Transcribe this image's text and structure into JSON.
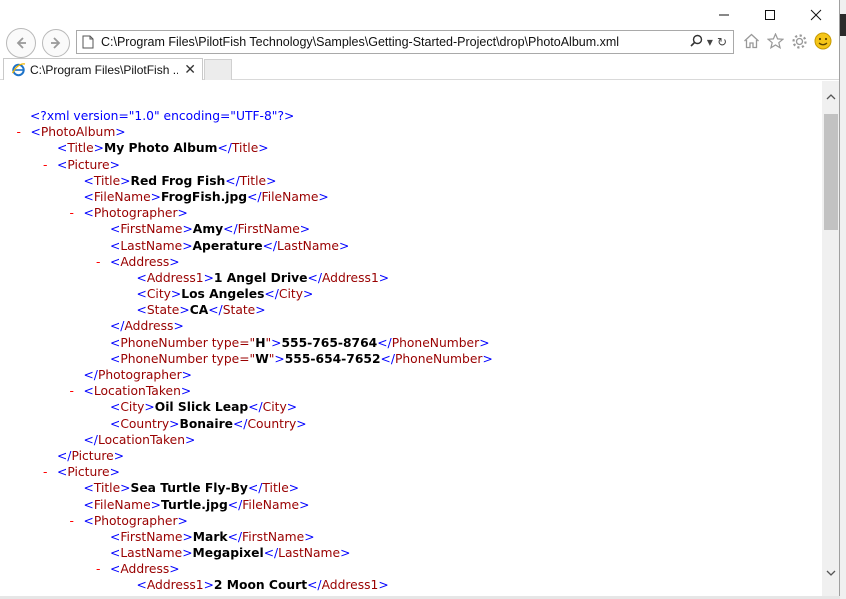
{
  "window": {
    "minimize_glyph": "—",
    "maximize_glyph": "☐",
    "close_glyph": "✕"
  },
  "address_bar": {
    "url": "C:\\Program Files\\PilotFish Technology\\Samples\\Getting-Started-Project\\drop\\PhotoAlbum.xml",
    "search_glyph": "⌕",
    "dropdown_glyph": "▾",
    "refresh_glyph": "↻"
  },
  "toolbar_icons": [
    "home-icon",
    "favorites-star-icon",
    "settings-gear-icon",
    "smiley-feedback-icon"
  ],
  "tab": {
    "title": "C:\\Program Files\\PilotFish ...",
    "close_glyph": "✕"
  },
  "xml": {
    "declaration": "<?xml version=\"1.0\" encoding=\"UTF-8\"?>",
    "lines": [
      {
        "indent": 1,
        "minus": true,
        "open": "PhotoAlbum"
      },
      {
        "indent": 2,
        "minus": false,
        "tag": "Title",
        "value": "My Photo Album"
      },
      {
        "indent": 2,
        "minus": true,
        "open": "Picture"
      },
      {
        "indent": 3,
        "minus": false,
        "tag": "Title",
        "value": "Red Frog Fish"
      },
      {
        "indent": 3,
        "minus": false,
        "tag": "FileName",
        "value": "FrogFish.jpg"
      },
      {
        "indent": 3,
        "minus": true,
        "open": "Photographer"
      },
      {
        "indent": 4,
        "minus": false,
        "tag": "FirstName",
        "value": "Amy"
      },
      {
        "indent": 4,
        "minus": false,
        "tag": "LastName",
        "value": "Aperature"
      },
      {
        "indent": 4,
        "minus": true,
        "open": "Address"
      },
      {
        "indent": 5,
        "minus": false,
        "tag": "Address1",
        "value": "1 Angel Drive"
      },
      {
        "indent": 5,
        "minus": false,
        "tag": "City",
        "value": "Los Angeles"
      },
      {
        "indent": 5,
        "minus": false,
        "tag": "State",
        "value": "CA"
      },
      {
        "indent": 4,
        "minus": false,
        "close": "Address"
      },
      {
        "indent": 4,
        "minus": false,
        "tag": "PhoneNumber",
        "attr": "type",
        "attr_value": "H",
        "value": "555-765-8764"
      },
      {
        "indent": 4,
        "minus": false,
        "tag": "PhoneNumber",
        "attr": "type",
        "attr_value": "W",
        "value": "555-654-7652"
      },
      {
        "indent": 3,
        "minus": false,
        "close": "Photographer"
      },
      {
        "indent": 3,
        "minus": true,
        "open": "LocationTaken"
      },
      {
        "indent": 4,
        "minus": false,
        "tag": "City",
        "value": "Oil Slick Leap"
      },
      {
        "indent": 4,
        "minus": false,
        "tag": "Country",
        "value": "Bonaire"
      },
      {
        "indent": 3,
        "minus": false,
        "close": "LocationTaken"
      },
      {
        "indent": 2,
        "minus": false,
        "close": "Picture"
      },
      {
        "indent": 2,
        "minus": true,
        "open": "Picture"
      },
      {
        "indent": 3,
        "minus": false,
        "tag": "Title",
        "value": "Sea Turtle Fly-By"
      },
      {
        "indent": 3,
        "minus": false,
        "tag": "FileName",
        "value": "Turtle.jpg"
      },
      {
        "indent": 3,
        "minus": true,
        "open": "Photographer"
      },
      {
        "indent": 4,
        "minus": false,
        "tag": "FirstName",
        "value": "Mark"
      },
      {
        "indent": 4,
        "minus": false,
        "tag": "LastName",
        "value": "Megapixel"
      },
      {
        "indent": 4,
        "minus": true,
        "open": "Address"
      },
      {
        "indent": 5,
        "minus": false,
        "tag": "Address1",
        "value": "2 Moon Court"
      }
    ]
  },
  "colors": {
    "tag": "#990000",
    "bracket": "#0000ff",
    "minus": "#ff0000",
    "value": "#000000"
  }
}
